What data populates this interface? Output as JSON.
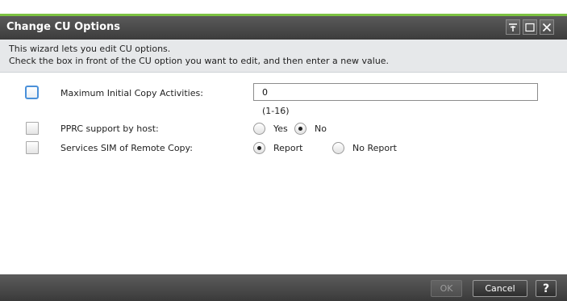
{
  "window": {
    "title": "Change CU Options",
    "controls": [
      "pin-icon",
      "maximize-icon",
      "close-icon"
    ]
  },
  "info": {
    "line1": "This wizard lets you edit CU options.",
    "line2": "Check the box in front of the CU option you want to edit, and then enter a new value."
  },
  "options": {
    "max_copy": {
      "label": "Maximum Initial Copy Activities:",
      "value": "0",
      "range": "(1-16)",
      "checked": false
    },
    "pprc": {
      "label": "PPRC support by host:",
      "checked": false,
      "choices": [
        "Yes",
        "No"
      ],
      "selected": "No"
    },
    "sim": {
      "label": "Services SIM of Remote Copy:",
      "checked": false,
      "choices": [
        "Report",
        "No Report"
      ],
      "selected": "Report"
    }
  },
  "footer": {
    "ok_label": "OK",
    "cancel_label": "Cancel",
    "help_label": "?"
  },
  "colors": {
    "accent": "#7cc242",
    "titlebar": "#4a4a4a",
    "focus": "#4a90d9"
  }
}
